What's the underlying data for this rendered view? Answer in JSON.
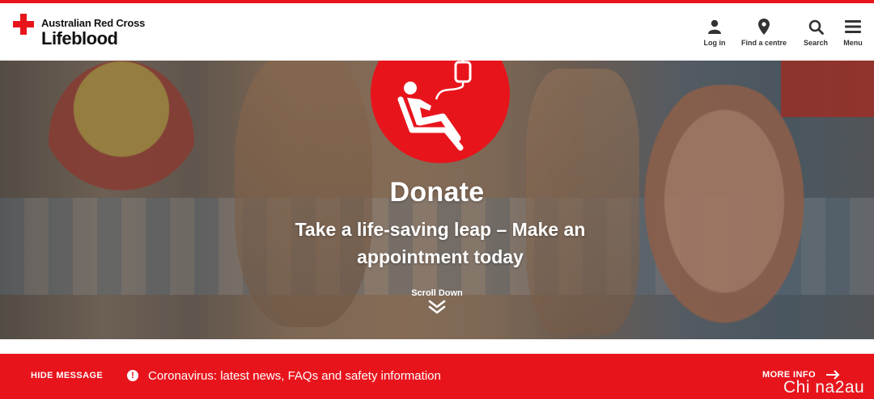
{
  "header": {
    "org_name": "Australian Red Cross",
    "brand_name": "Lifeblood",
    "logo_icon": "red-cross-icon",
    "nav": [
      {
        "label": "Log in",
        "icon": "user-icon"
      },
      {
        "label": "Find a centre",
        "icon": "map-pin-icon"
      },
      {
        "label": "Search",
        "icon": "search-icon"
      },
      {
        "label": "Menu",
        "icon": "hamburger-icon"
      }
    ]
  },
  "hero": {
    "icon": "blood-donation-chair-icon",
    "title": "Donate",
    "subtitle": "Take a life-saving leap – Make an appointment today",
    "scroll_label": "Scroll Down",
    "scroll_icon": "double-chevron-down-icon"
  },
  "alert": {
    "hide_label": "HIDE MESSAGE",
    "icon": "exclamation-circle-icon",
    "icon_glyph": "!",
    "message": "Coronavirus: latest news, FAQs and safety information",
    "more_label": "MORE INFO",
    "more_icon": "arrow-right-icon",
    "watermark": "Chi na2au"
  },
  "colors": {
    "brand_red": "#e8141c",
    "text_dark": "#111111",
    "white": "#ffffff"
  }
}
